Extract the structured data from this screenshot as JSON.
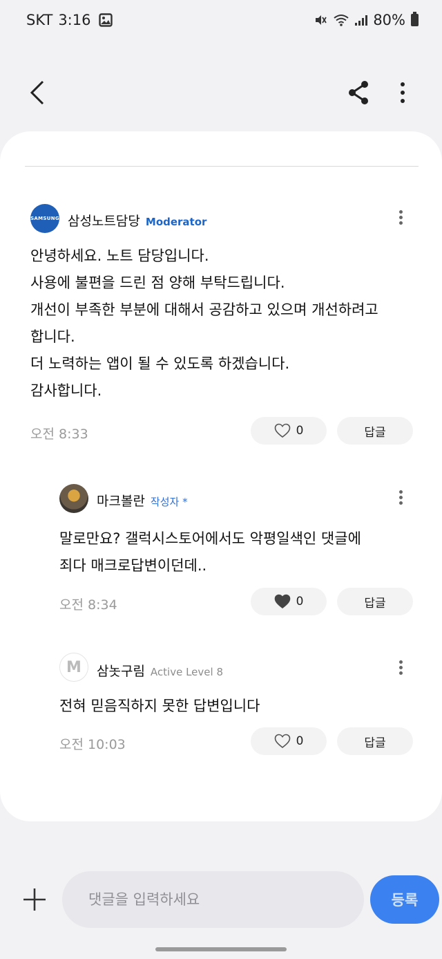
{
  "status_bar": {
    "carrier": "SKT",
    "time": "3:16",
    "battery": "80%"
  },
  "comments": [
    {
      "author": "삼성노트담당",
      "badge": "Moderator",
      "avatar_text": "SAMSUNG",
      "text": "안녕하세요. 노트 담당입니다.\n사용에 불편을 드린 점 양해 부탁드립니다.\n개선이 부족한 부분에 대해서 공감하고 있으며 개선하려고\n합니다.\n더 노력하는 앱이 될 수 있도록 하겠습니다.\n감사합니다.",
      "time": "오전 8:33",
      "likes": "0",
      "liked": false,
      "reply_label": "답글"
    },
    {
      "author": "마크볼란",
      "badge": "작성자 *",
      "text": "말로만요? 갤럭시스토어에서도 악평일색인 댓글에\n죄다 매크로답변이던데..",
      "time": "오전 8:34",
      "likes": "0",
      "liked": true,
      "reply_label": "답글"
    },
    {
      "author": "삼놋구림",
      "badge": "Active Level 8",
      "avatar_text": "M",
      "text": "전혀 믿음직하지 못한 답변입니다",
      "time": "오전 10:03",
      "likes": "0",
      "liked": false,
      "reply_label": "답글"
    }
  ],
  "composer": {
    "placeholder": "댓글을 입력하세요",
    "submit_label": "등록"
  },
  "colors": {
    "accent": "#3b82f0",
    "moderator": "#1d66c9",
    "background": "#f2f2f5"
  }
}
